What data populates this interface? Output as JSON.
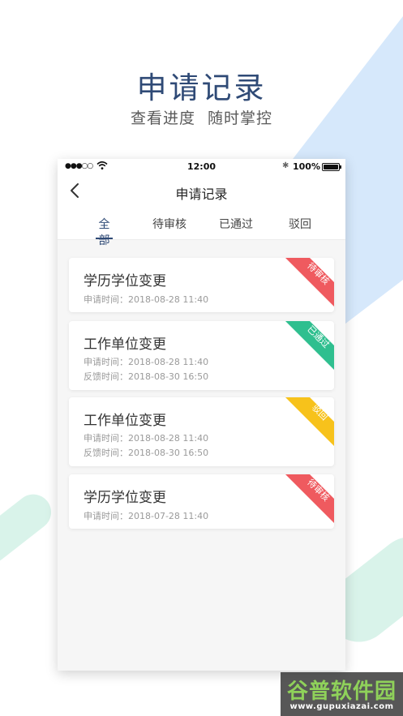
{
  "hero": {
    "title": "申请记录",
    "subtitle": "查看进度 随时掌控"
  },
  "status_bar": {
    "signal": "●●●○○",
    "time": "12:00",
    "battery": "100%",
    "battery_level": 100
  },
  "nav": {
    "back_icon": "chevron-left-icon",
    "title": "申请记录"
  },
  "tabs": [
    {
      "label": "全部",
      "active": true
    },
    {
      "label": "待审核",
      "active": false
    },
    {
      "label": "已通过",
      "active": false
    },
    {
      "label": "驳回",
      "active": false
    }
  ],
  "records": [
    {
      "title": "学历学位变更",
      "apply_time": "申请时间：2018-08-28 11:40",
      "status": "待审核"
    },
    {
      "title": "工作单位变更",
      "apply_time": "申请时间：2018-08-28 11:40",
      "feedback_time": "反馈时间：2018-08-30 16:50",
      "status": "已通过"
    },
    {
      "title": "工作单位变更",
      "apply_time": "申请时间：2018-08-28 11:40",
      "feedback_time": "反馈时间：2018-08-30 16:50",
      "status": "驳回"
    },
    {
      "title": "学历学位变更",
      "apply_time": "申请时间：2018-07-28 11:40",
      "status": "待审核"
    }
  ],
  "colors": {
    "accent": "#2f4a76",
    "pending": "#ef5a5f",
    "approved": "#2fbf8f",
    "rejected": "#f7c21b",
    "bg_blue": "#d6e8fb",
    "bg_green": "#d9f3ea"
  },
  "watermark": {
    "title": "谷普软件园",
    "url": "www.gupuxiazai.com"
  }
}
